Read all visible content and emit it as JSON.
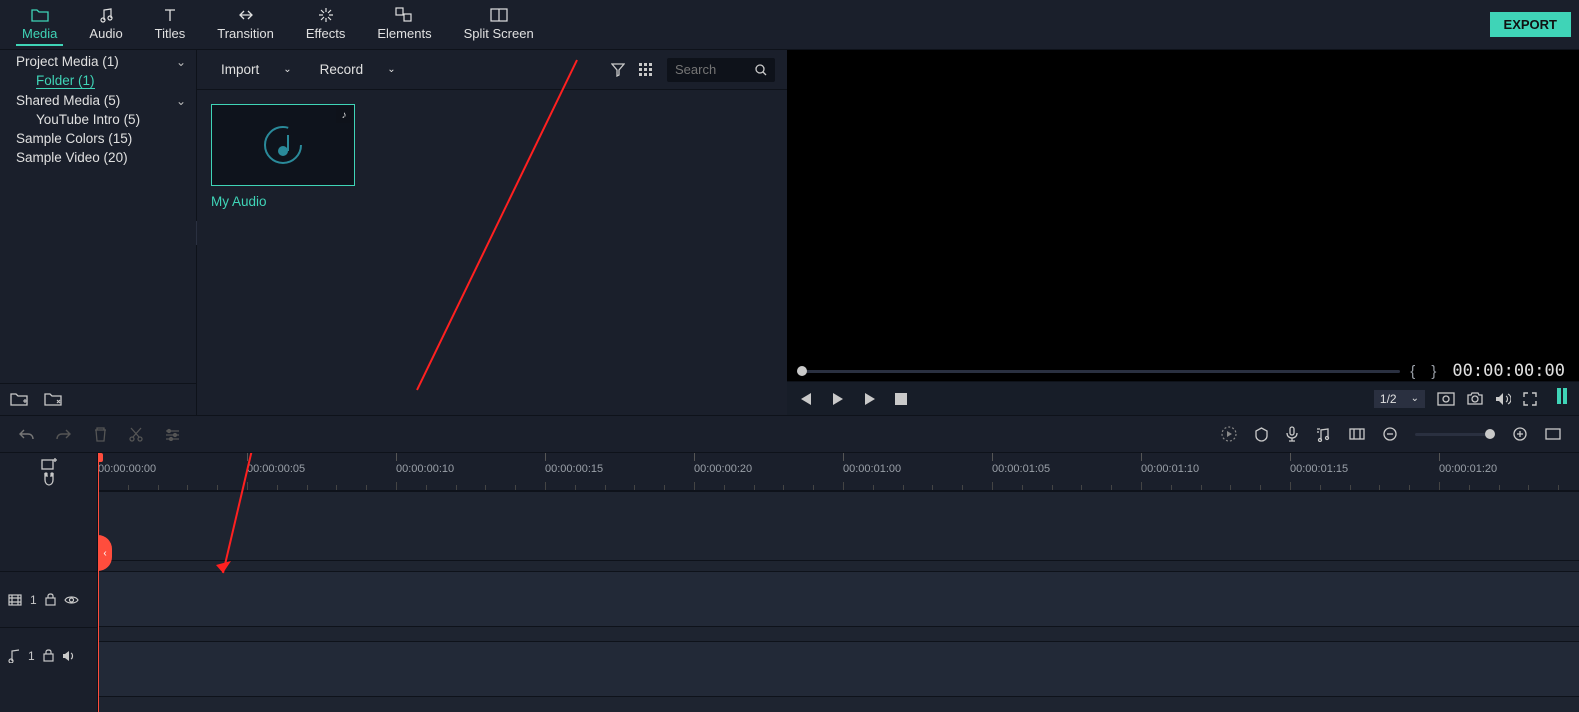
{
  "tabs": {
    "media": "Media",
    "audio": "Audio",
    "titles": "Titles",
    "transition": "Transition",
    "effects": "Effects",
    "elements": "Elements",
    "split": "Split Screen"
  },
  "export_label": "EXPORT",
  "sidebar": {
    "project_media": "Project Media (1)",
    "folder": "Folder (1)",
    "shared_media": "Shared Media (5)",
    "youtube_intro": "YouTube Intro (5)",
    "sample_colors": "Sample Colors (15)",
    "sample_video": "Sample Video (20)"
  },
  "media_toolbar": {
    "import": "Import",
    "record": "Record",
    "search_placeholder": "Search"
  },
  "media_items": [
    {
      "label": "My Audio"
    }
  ],
  "preview": {
    "timecode": "00:00:00:00",
    "zoom": "1/2",
    "braces": "{   }"
  },
  "ruler_marks": [
    "00:00:00:00",
    "00:00:00:05",
    "00:00:00:10",
    "00:00:00:15",
    "00:00:00:20",
    "00:00:01:00",
    "00:00:01:05",
    "00:00:01:10",
    "00:00:01:15",
    "00:00:01:20"
  ],
  "tracks": {
    "video_index": "1",
    "audio_index": "1"
  }
}
